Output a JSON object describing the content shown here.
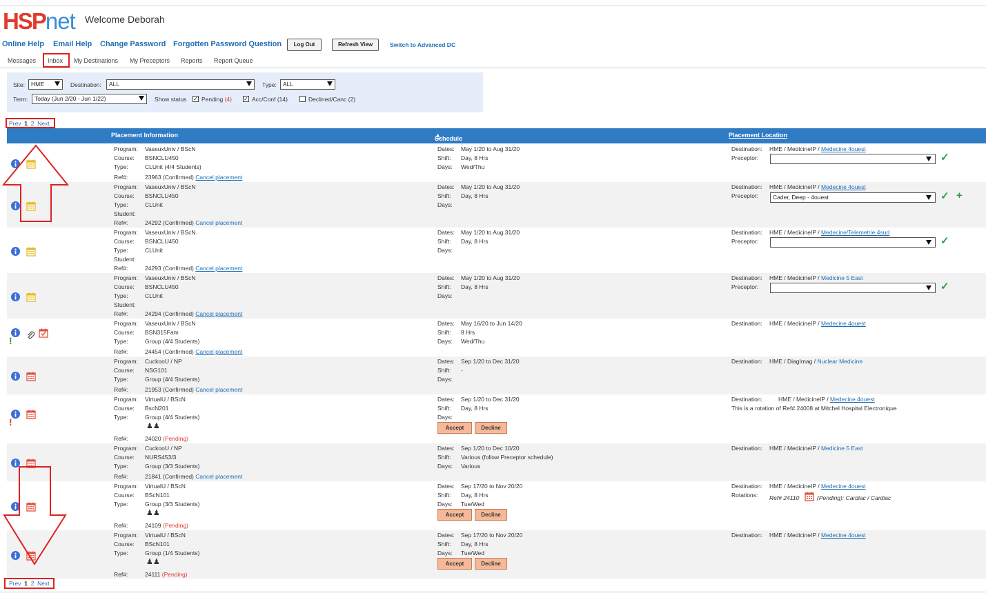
{
  "brand": {
    "logo_hs": "HSP",
    "logo_net": "net"
  },
  "welcome": "Welcome Deborah",
  "toplinks": {
    "online_help": "Online Help",
    "email_help": "Email Help",
    "change_password": "Change Password",
    "forgotten": "Forgotten Password Question",
    "logout": "Log Out",
    "refresh": "Refresh View",
    "switch": "Switch to Advanced DC"
  },
  "tabs": {
    "messages": "Messages",
    "inbox": "Inbox",
    "my_destinations": "My Destinations",
    "my_preceptors": "My Preceptors",
    "reports": "Reports",
    "report_queue": "Report Queue"
  },
  "filters": {
    "site_label": "Site:",
    "site_value": "HME",
    "destination_label": "Destination:",
    "destination_value": "ALL",
    "type_label": "Type:",
    "type_value": "ALL",
    "term_label": "Term:",
    "term_value": "Today (Jun 2/20 - Jun 1/22)",
    "show_status": "Show status",
    "pending_label": "Pending",
    "pending_count": "(4)",
    "accconf_label": "Acc/Conf (14)",
    "declined_label": "Declined/Canc (2)"
  },
  "pager": {
    "prev": "Prev",
    "p1": "1",
    "p2": "2",
    "next": "Next"
  },
  "table": {
    "col_info": "Placement Information",
    "col_schedule": "Schedule",
    "col_location": "Placement Location"
  },
  "labels": {
    "program": "Program:",
    "course": "Course:",
    "type": "Type:",
    "student": "Student:",
    "ref": "Ref#:",
    "dates": "Dates:",
    "shift": "Shift:",
    "days": "Days:",
    "destination": "Destination:",
    "preceptor": "Preceptor:",
    "rotations": "Rotations:",
    "cancel": "Cancel placement",
    "accept": "Accept",
    "decline": "Decline"
  },
  "rows": [
    {
      "program": "VaseuxUniv / BScN",
      "course": "BSNCLU450",
      "type": "CLUnit (4/4 Students)",
      "ref": "23963",
      "status": "(Confirmed)",
      "dates": "May 1/20 to Aug 31/20",
      "shift": "Day, 8 Hrs",
      "days": "Wed/Thu",
      "dest_prefix": "HME / MedicineIP / ",
      "dest_link": "Medecine 4ouest",
      "preceptor": ""
    },
    {
      "program": "VaseuxUniv / BScN",
      "course": "BSNCLU450",
      "type": "CLUnit",
      "ref": "24292",
      "status": "(Confirmed)",
      "dates": "May 1/20 to Aug 31/20",
      "shift": "Day, 8 Hrs",
      "days": "",
      "dest_prefix": "HME / MedicineIP / ",
      "dest_link": "Medecine 4ouest",
      "preceptor": "Cader, Deep - 4ouest"
    },
    {
      "program": "VaseuxUniv / BScN",
      "course": "BSNCLU450",
      "type": "CLUnit",
      "ref": "24293",
      "status": "(Confirmed)",
      "dates": "May 1/20 to Aug 31/20",
      "shift": "Day, 8 Hrs",
      "days": "",
      "dest_prefix": "HME / MedicineIP / ",
      "dest_link": "Medecine/Telemetrie 4sud",
      "preceptor": ""
    },
    {
      "program": "VaseuxUniv / BScN",
      "course": "BSNCLU450",
      "type": "CLUnit",
      "ref": "24294",
      "status": "(Confirmed)",
      "dates": "May 1/20 to Aug 31/20",
      "shift": "Day, 8 Hrs",
      "days": "",
      "dest_prefix": "HME / MedicineIP / ",
      "dest_link": "Medicine 5 East",
      "preceptor": ""
    },
    {
      "program": "VaseuxUniv / BScN",
      "course": "BSN315Fam",
      "type": "Group (4/4 Students)",
      "ref": "24454",
      "status": "(Confirmed)",
      "dates": "May 16/20 to Jun 14/20",
      "shift": "8 Hrs",
      "days": "Wed/Thu",
      "dest_prefix": "HME / MedicineIP / ",
      "dest_link": "Medecine 4ouest"
    },
    {
      "program": "CuckooU / NP",
      "course": "NSG101",
      "type": "Group (4/4 Students)",
      "ref": "21953",
      "status": "(Confirmed)",
      "dates": "Sep 1/20 to Dec 31/20",
      "shift": "-",
      "days": "",
      "dest_prefix": "HME / DiagImag / ",
      "dest_link": "Nuclear Medicine"
    },
    {
      "program": "VirtualU / BScN",
      "course": "BscN201",
      "type": "Group (4/4 Students)",
      "ref": "24020",
      "status": "(Pending)",
      "dates": "Sep 1/20 to Dec 31/20",
      "shift": "Day, 8 Hrs",
      "days": "",
      "dest_prefix": "HME / MedicineIP / ",
      "dest_link": "Medecine 4ouest",
      "note": "This is a rotation of Ref# 24008 at Mitchel Hospital Electronique"
    },
    {
      "program": "CuckooU / NP",
      "course": "NURS453/3",
      "type": "Group (3/3 Students)",
      "ref": "21841",
      "status": "(Confirmed)",
      "dates": "Sep 1/20 to Dec 10/20",
      "shift": "Various (follow Preceptor schedule)",
      "days": "Various",
      "dest_prefix": "HME / MedicineIP / ",
      "dest_link": "Medicine 5 East"
    },
    {
      "program": "VirtualU / BScN",
      "course": "BScN101",
      "type": "Group (3/3 Students)",
      "ref": "24109",
      "status": "(Pending)",
      "dates": "Sep 17/20 to Nov 20/20",
      "shift": "Day, 8 Hrs",
      "days": "Tue/Wed",
      "dest_prefix": "HME / MedicineIP / ",
      "dest_link": "Medecine 4ouest",
      "rotation_ref": "Ref# 24110",
      "rotation_text": "(Pending): Cardiac / Cardiac"
    },
    {
      "program": "VirtualU / BScN",
      "course": "BScN101",
      "type": "Group (1/4 Students)",
      "ref": "24111",
      "status": "(Pending)",
      "dates": "Sep 17/20 to Nov 20/20",
      "shift": "Day, 8 Hrs",
      "days": "Tue/Wed",
      "dest_prefix": "HME / MedicineIP / ",
      "dest_link": "Medecine 4ouest"
    }
  ],
  "colors": {
    "header": "#2f7bc4",
    "link": "#1f6fb5",
    "pending": "#e03a2f",
    "annot": "#e02020",
    "accept": "#f5b99a",
    "check": "#2e9e3e"
  }
}
